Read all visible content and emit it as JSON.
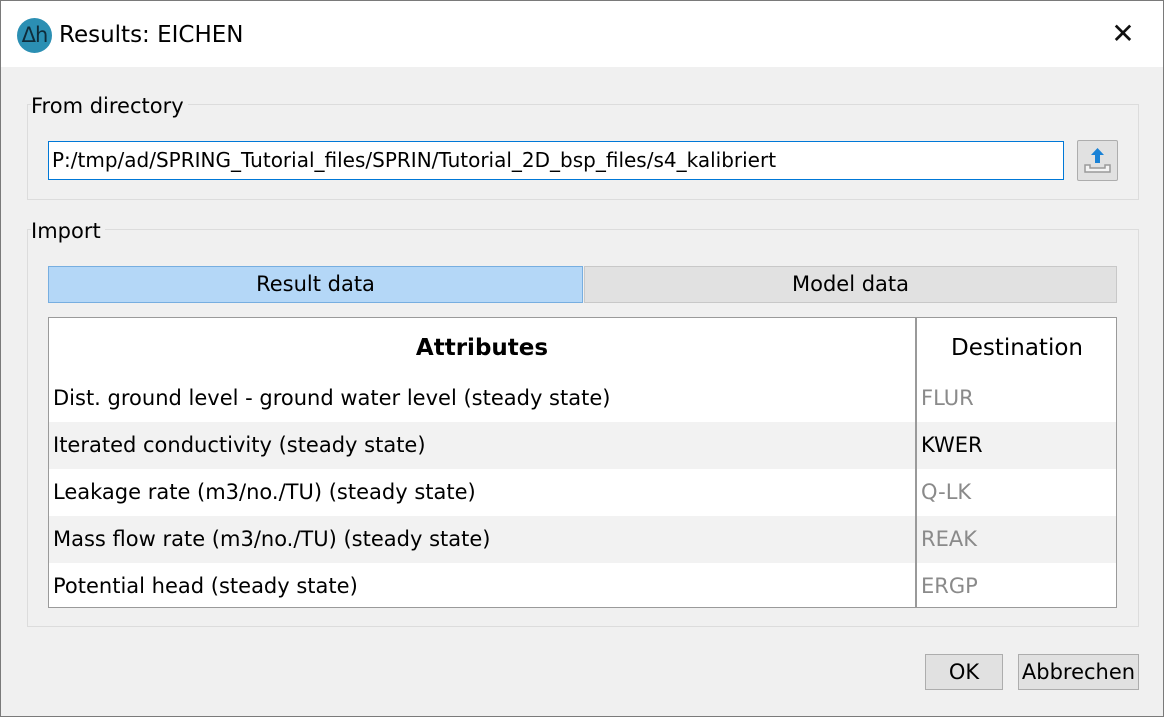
{
  "window": {
    "title": "Results: EICHEN",
    "app_icon_glyph": "Δh",
    "close_glyph": "✕"
  },
  "from_directory": {
    "label": "From directory",
    "path": "P:/tmp/ad/SPRING_Tutorial_files/SPRIN/Tutorial_2D_bsp_files/s4_kalibriert",
    "upload_icon": "upload-folder-icon"
  },
  "import": {
    "label": "Import",
    "tabs": [
      {
        "label": "Result data",
        "active": true
      },
      {
        "label": "Model data",
        "active": false
      }
    ],
    "table": {
      "headers": {
        "attributes": "Attributes",
        "destination": "Destination"
      },
      "rows": [
        {
          "attribute": "Dist. ground level - ground water level (steady state)",
          "destination": "FLUR",
          "enabled": false
        },
        {
          "attribute": "Iterated conductivity (steady state)",
          "destination": "KWER",
          "enabled": true
        },
        {
          "attribute": "Leakage rate (m3/no./TU) (steady state)",
          "destination": "Q-LK",
          "enabled": false
        },
        {
          "attribute": "Mass flow rate (m3/no./TU) (steady state)",
          "destination": "REAK",
          "enabled": false
        },
        {
          "attribute": "Potential head (steady state)",
          "destination": "ERGP",
          "enabled": false
        }
      ]
    }
  },
  "buttons": {
    "ok": "OK",
    "cancel": "Abbrechen"
  },
  "colors": {
    "active_tab": "#b4d7f7",
    "disabled_text": "#8a8a8a",
    "input_focus_border": "#0078d7"
  }
}
